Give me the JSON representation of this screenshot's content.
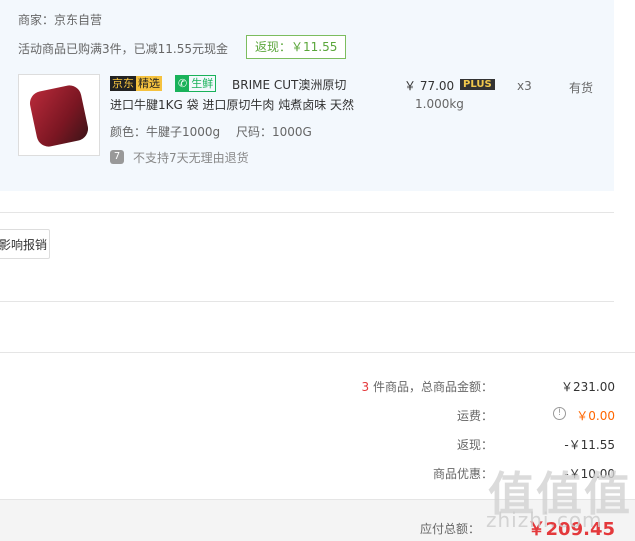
{
  "item": {
    "seller": "商家：京东自营",
    "promo": "活动商品已购满3件，已减11.55元现金",
    "cashback_badge": "返现：￥11.55",
    "tag_jd_a": "京东",
    "tag_jd_b": "精选",
    "tag_fresh_icon": "✆",
    "tag_fresh_label": "生鲜",
    "title_line1": "BRIME CUT澳洲原切",
    "title_line2": "进口牛腱1KG 袋 进口原切牛肉 炖煮卤味 天然",
    "spec": "颜色：牛腱子1000g　 尺码：1000G",
    "return_note": "不支持7天无理由退货",
    "price": "￥ 77.00",
    "plus_badge": "PLUS",
    "weight": "1.000kg",
    "quantity": "x3",
    "stock": "有货"
  },
  "report_button": "影响报销",
  "summary": {
    "count": "3",
    "count_suffix": " 件商品，总商品金额：",
    "goods_total": "￥231.00",
    "shipping_label": "运费：",
    "shipping_value": "￥0.00",
    "cashback_label": "返现：",
    "cashback_value": "-￥11.55",
    "discount_label": "商品优惠：",
    "discount_value": "-￥10.00"
  },
  "total": {
    "label": "应付总额：",
    "value": "￥209.45"
  },
  "watermark": {
    "main": "值值值",
    "sub": "zhizhi.com"
  },
  "colors": {
    "panel_bg": "#f3f8fd",
    "accent_red": "#e4393c",
    "shipping_orange": "#ff6600",
    "cashback_green": "#5aa63a"
  },
  "icons": [
    "no-return-icon",
    "info-icon"
  ]
}
